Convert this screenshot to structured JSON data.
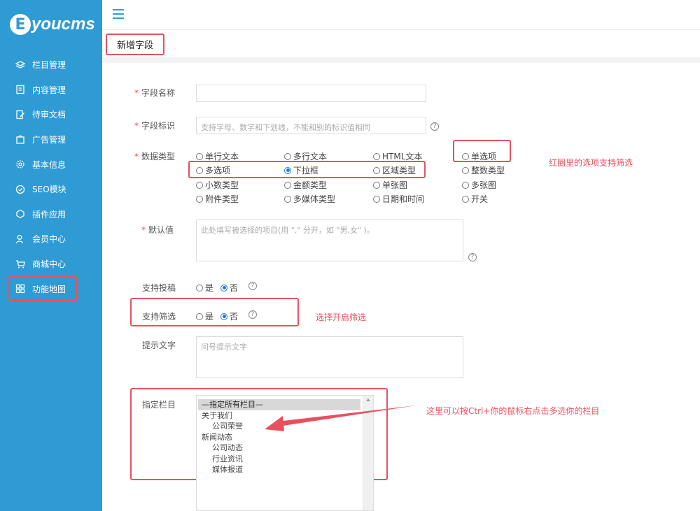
{
  "brand": {
    "badge": "E",
    "name": "youcms"
  },
  "sidebar": {
    "items": [
      {
        "label": "栏目管理",
        "icon": "layers-icon"
      },
      {
        "label": "内容管理",
        "icon": "document-icon"
      },
      {
        "label": "待审文档",
        "icon": "edit-document-icon"
      },
      {
        "label": "广告管理",
        "icon": "ad-icon"
      },
      {
        "label": "基本信息",
        "icon": "gear-icon"
      },
      {
        "label": "SEO模块",
        "icon": "seo-icon"
      },
      {
        "label": "插件应用",
        "icon": "plugin-icon"
      },
      {
        "label": "会员中心",
        "icon": "user-icon"
      },
      {
        "label": "商城中心",
        "icon": "cart-icon"
      },
      {
        "label": "功能地图",
        "icon": "grid-icon"
      }
    ]
  },
  "tabs": {
    "active": "新增字段"
  },
  "form": {
    "field_name": {
      "label": "字段名称",
      "value": ""
    },
    "field_id": {
      "label": "字段标识",
      "placeholder": "支持字母、数字和下划线，不能和别的标识值相同"
    },
    "data_type": {
      "label": "数据类型",
      "options": [
        "单行文本",
        "多行文本",
        "HTML文本",
        "单选项",
        "多选项",
        "下拉框",
        "区域类型",
        "整数类型",
        "小数类型",
        "金额类型",
        "单张图",
        "多张图",
        "附件类型",
        "多媒体类型",
        "日期和时间",
        "开关"
      ],
      "selected": "下拉框"
    },
    "default_value": {
      "label": "默认值",
      "placeholder": "此处填写被选择的项目(用 \",\" 分开，如 \"男,女\" )。"
    },
    "allow_submit": {
      "label": "支持投稿",
      "yes": "是",
      "no": "否",
      "selected": "否"
    },
    "allow_filter": {
      "label": "支持筛选",
      "yes": "是",
      "no": "否",
      "selected": "否"
    },
    "hint_text": {
      "label": "提示文字",
      "placeholder": "问号提示文字"
    },
    "columns": {
      "label": "指定栏目",
      "options": [
        {
          "text": "—指定所有栏目—",
          "level": 1,
          "selected": true
        },
        {
          "text": "关于我们",
          "level": 1,
          "selected": false
        },
        {
          "text": "公司荣誉",
          "level": 2,
          "selected": false
        },
        {
          "text": "新闻动态",
          "level": 1,
          "selected": false
        },
        {
          "text": "公司动态",
          "level": 2,
          "selected": false
        },
        {
          "text": "行业资讯",
          "level": 2,
          "selected": false
        },
        {
          "text": "媒体报道",
          "level": 2,
          "selected": false
        }
      ]
    }
  },
  "annotations": {
    "radio_note": "红圈里的选项支持筛选",
    "filter_note": "选择开启筛选",
    "column_note": "这里可以按Ctrl+你的鼠标右点击多选你的栏目"
  },
  "colors": {
    "sidebar": "#2f9bd4",
    "highlight": "#e8505e",
    "radio_selected": "#1e7bd6"
  }
}
